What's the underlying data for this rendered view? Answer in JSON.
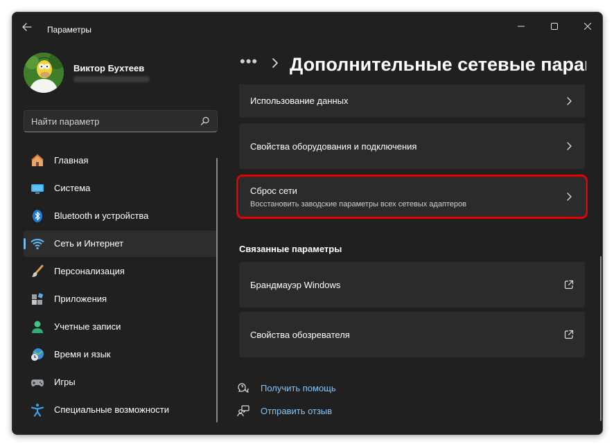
{
  "app": {
    "title": "Параметры"
  },
  "profile": {
    "name": "Виктор Бухтеев"
  },
  "search": {
    "placeholder": "Найти параметр"
  },
  "nav": {
    "items": [
      {
        "label": "Главная",
        "icon": "home-icon",
        "active": false
      },
      {
        "label": "Система",
        "icon": "system-icon",
        "active": false
      },
      {
        "label": "Bluetooth и устройства",
        "icon": "bluetooth-icon",
        "active": false
      },
      {
        "label": "Сеть и Интернет",
        "icon": "wifi-icon",
        "active": true
      },
      {
        "label": "Персонализация",
        "icon": "brush-icon",
        "active": false
      },
      {
        "label": "Приложения",
        "icon": "apps-icon",
        "active": false
      },
      {
        "label": "Учетные записи",
        "icon": "account-icon",
        "active": false
      },
      {
        "label": "Время и язык",
        "icon": "globe-clock-icon",
        "active": false
      },
      {
        "label": "Игры",
        "icon": "gamepad-icon",
        "active": false
      },
      {
        "label": "Специальные возможности",
        "icon": "accessibility-icon",
        "active": false
      }
    ]
  },
  "breadcrumb": {
    "more": "•••",
    "title": "Дополнительные сетевые парам"
  },
  "settings": {
    "data_usage": "Использование данных",
    "hardware": "Свойства оборудования и подключения",
    "reset_title": "Сброс сети",
    "reset_subtitle": "Восстановить заводские параметры всех сетевых адаптеров"
  },
  "related": {
    "heading": "Связанные параметры",
    "firewall": "Брандмауэр Windows",
    "browser": "Свойства обозревателя"
  },
  "help": {
    "get_help": "Получить помощь",
    "feedback": "Отправить отзыв"
  },
  "colors": {
    "background": "#202020",
    "card": "#2b2b2b",
    "accent": "#76b9ed",
    "link": "#87c4f5",
    "highlight": "#e20000"
  }
}
